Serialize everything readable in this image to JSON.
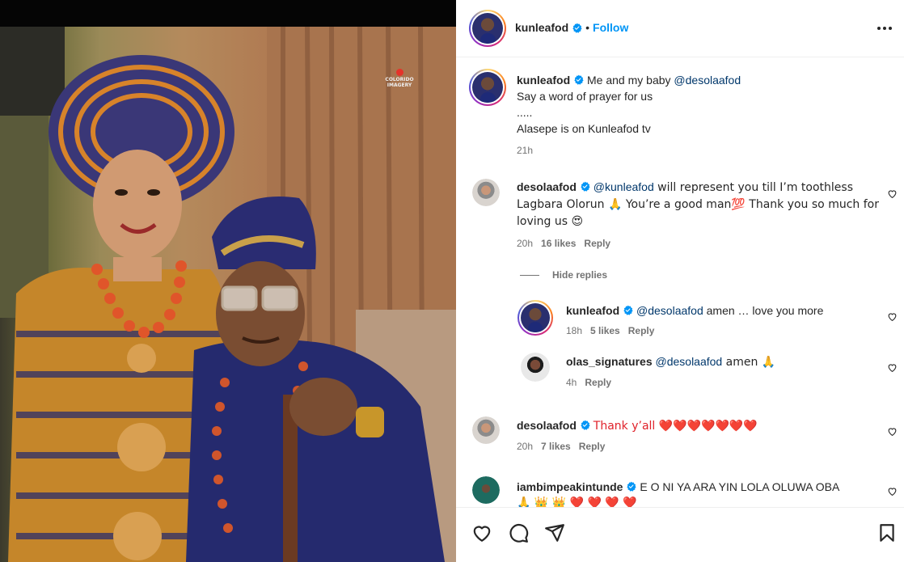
{
  "watermark": {
    "brand": "COLORIDO",
    "sub": "IMAGERY"
  },
  "header": {
    "username": "kunleafod",
    "separator": "•",
    "follow_label": "Follow"
  },
  "caption": {
    "username": "kunleafod",
    "text": "Me and my baby ",
    "mention": "@desolaafod",
    "line2": "Say a word of prayer for us",
    "line3": ".....",
    "line4": "Alasepe is on Kunleafod tv",
    "time": "21h"
  },
  "comments": [
    {
      "username": "desolaafod",
      "mention": "@kunleafod",
      "text": " will represent you till I’m toothless Lagbara Olorun 🙏 You’re a good man💯 Thank you so much for loving us 😍",
      "time": "20h",
      "likes": "16 likes",
      "reply_label": "Reply"
    },
    {
      "username": "desolaafod",
      "text": "Thank y’all ❤️❤️❤️❤️❤️❤️❤️",
      "time": "20h",
      "likes": "7 likes",
      "reply_label": "Reply"
    },
    {
      "username": "iambimpeakintunde",
      "text": "E O NI YA ARA YIN LOLA OLUWA OBA",
      "text2": "🙏 👑 👑 ❤️ ❤️ ❤️ ❤️"
    }
  ],
  "hide_replies_label": "Hide replies",
  "replies": [
    {
      "username": "kunleafod",
      "mention": "@desolaafod",
      "text": " amen … love you more",
      "time": "18h",
      "likes": "5 likes",
      "reply_label": "Reply"
    },
    {
      "username": "olas_signatures",
      "mention": "@desolaafod",
      "text": " amen 🙏",
      "time": "4h",
      "reply_label": "Reply"
    }
  ],
  "colors": {
    "link": "#0095f6",
    "mention": "#00376b",
    "verified": "#0095f6",
    "secondary": "#737373"
  },
  "icons": [
    "verified-badge-icon",
    "more-options-icon",
    "heart-icon",
    "comment-icon",
    "share-icon",
    "bookmark-icon"
  ]
}
